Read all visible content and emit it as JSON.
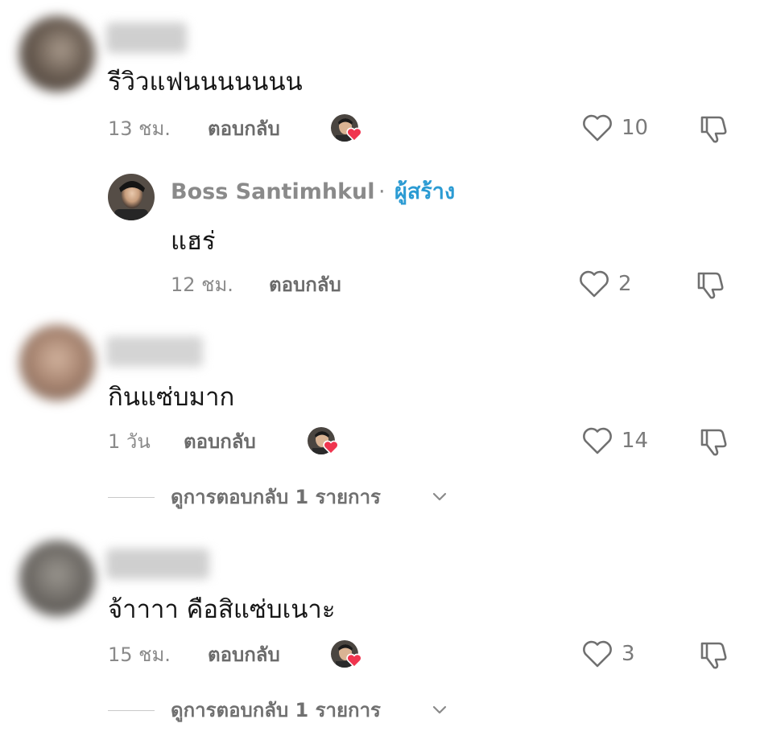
{
  "colors": {
    "text": "#161616",
    "meta": "#8a8a8a",
    "reply": "#6b6b6b",
    "creator_badge": "#2b9bd3",
    "heart": "#f0354f"
  },
  "icons": {
    "like": "heart-outline-icon",
    "dislike": "thumbs-down-outline-icon",
    "liked_by_creator": "creator-avatar-heart-icon",
    "expand": "chevron-down-icon"
  },
  "comments": [
    {
      "text": "รีวิวแฟนนนนนนน",
      "time": "13 ชม.",
      "reply_label": "ตอบกลับ",
      "likes": "10",
      "liked_by_creator": true
    },
    {
      "text": "กินแซ่บมาก",
      "time": "1 วัน",
      "reply_label": "ตอบกลับ",
      "likes": "14",
      "liked_by_creator": true,
      "view_replies": "ดูการตอบกลับ 1 รายการ"
    },
    {
      "text": "จ้าาาา คือสิแซ่บเนาะ",
      "time": "15 ชม.",
      "reply_label": "ตอบกลับ",
      "likes": "3",
      "liked_by_creator": true,
      "view_replies": "ดูการตอบกลับ 1 รายการ"
    }
  ],
  "creator_reply": {
    "author": "Boss Santimhkul",
    "separator": "·",
    "badge": "ผู้สร้าง",
    "text": "แฮร่",
    "time": "12 ชม.",
    "reply_label": "ตอบกลับ",
    "likes": "2"
  }
}
